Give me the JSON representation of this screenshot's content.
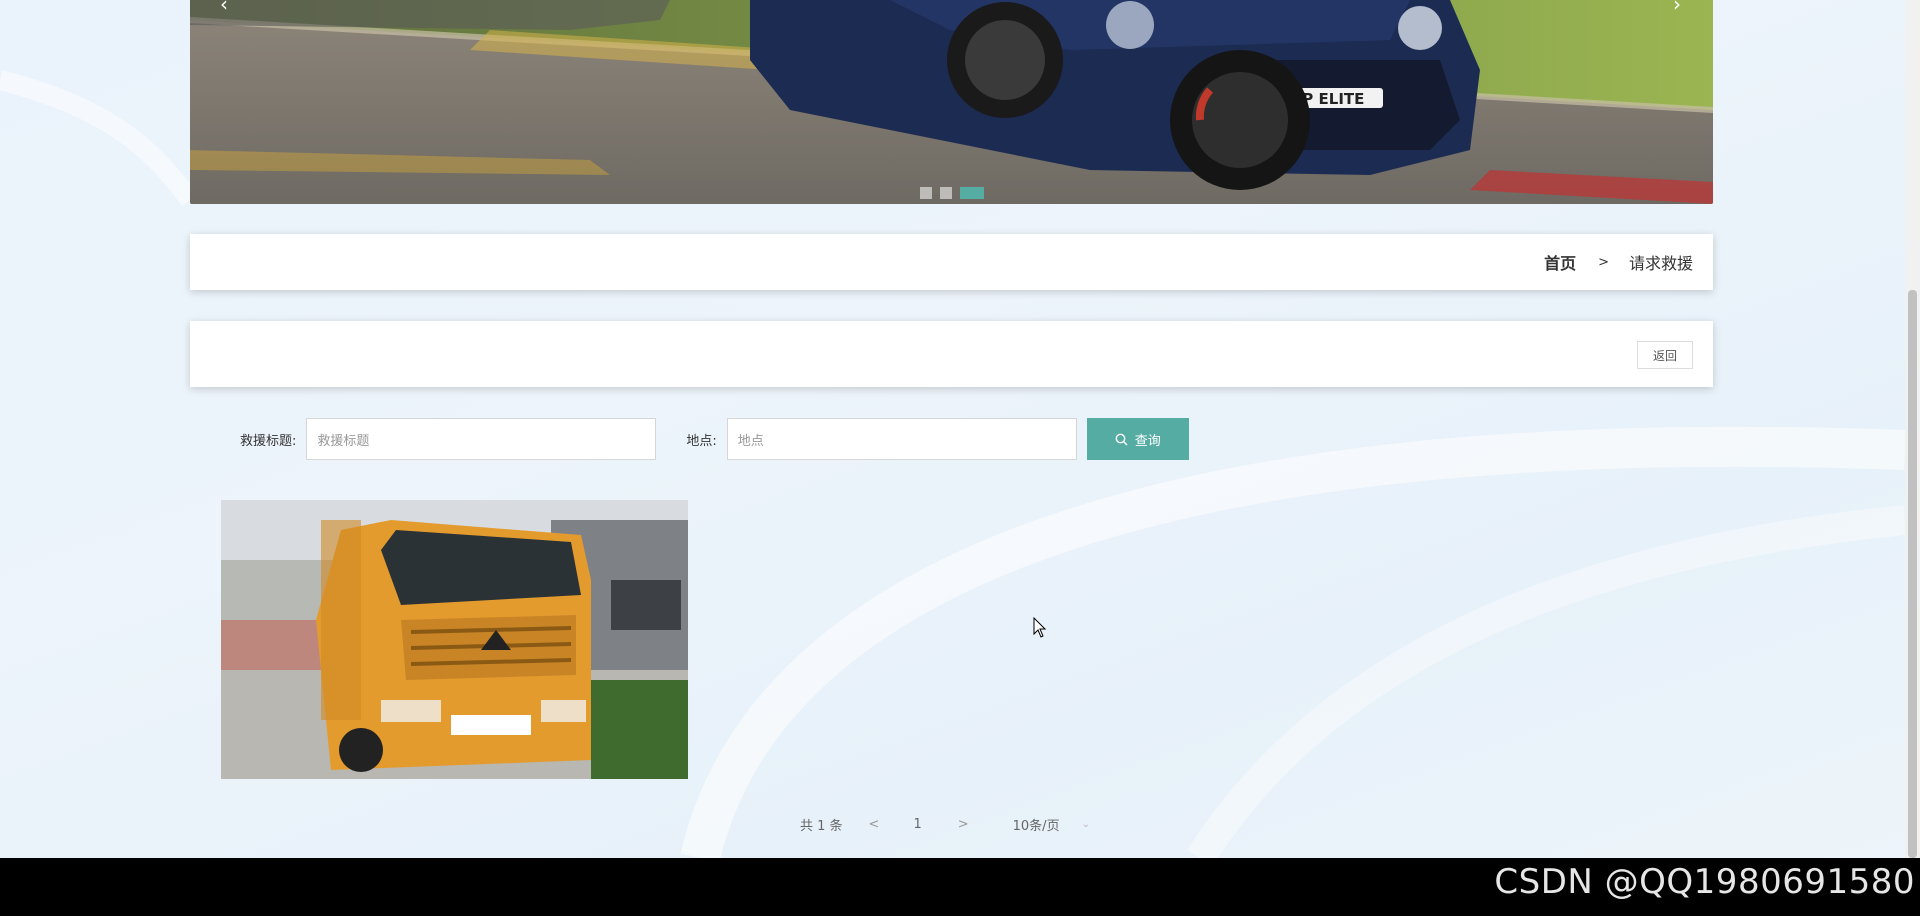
{
  "banner": {
    "prev_icon": "‹",
    "next_icon": "›",
    "slides": 3,
    "active_slide": 3,
    "plate_text": "GP ELITE"
  },
  "breadcrumb": {
    "home": "首页",
    "separator": ">",
    "current": "请求救援"
  },
  "back_button": "返回",
  "search": {
    "title_label": "救援标题:",
    "title_placeholder": "救援标题",
    "location_label": "地点:",
    "location_placeholder": "地点",
    "query_button": "查询",
    "query_icon": "search-icon"
  },
  "items": [
    {
      "image": "tow-truck-photo"
    }
  ],
  "pagination": {
    "total": "共 1 条",
    "prev": "<",
    "page": "1",
    "next": ">",
    "page_size": "10条/页",
    "page_size_arrow": "⌄"
  },
  "watermark": "CSDN @QQ1980691580",
  "colors": {
    "accent": "#54aca3",
    "footer": "#000000"
  }
}
